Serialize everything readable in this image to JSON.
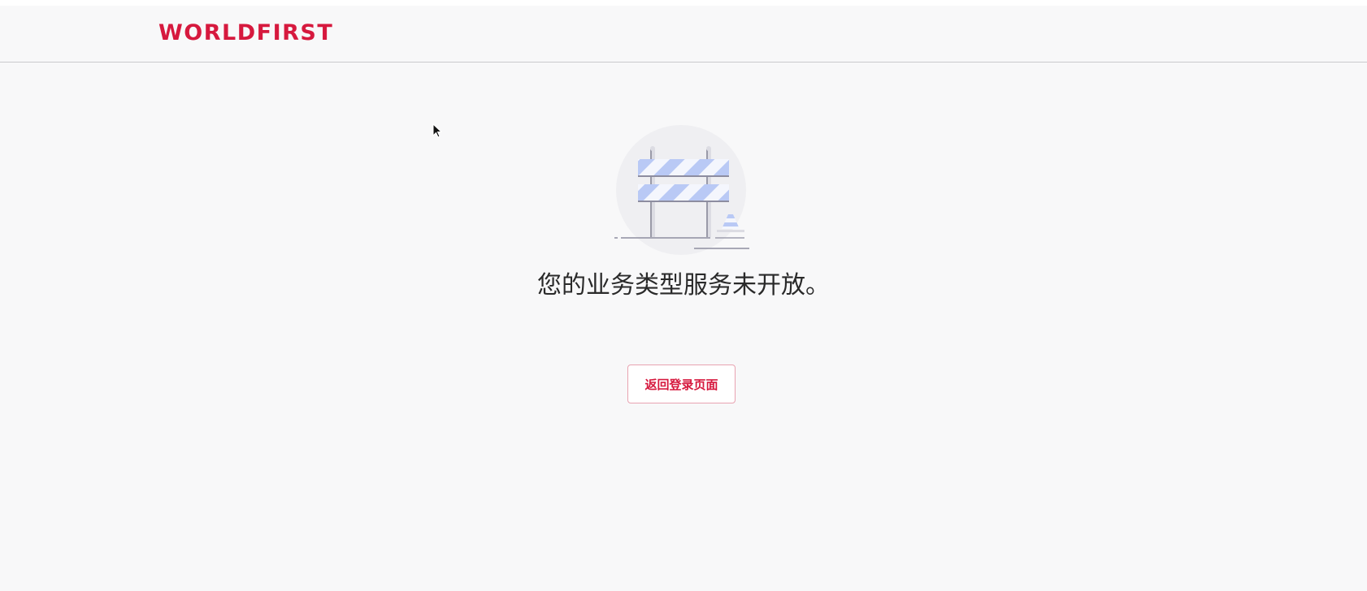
{
  "header": {
    "logo_text": "WORLDFIRST"
  },
  "main": {
    "illustration_icon": "roadblock-barrier-icon",
    "message": "您的业务类型服务未开放。",
    "back_button_label": "返回登录页面"
  },
  "colors": {
    "brand": "#d6193e",
    "background": "#f8f8f9",
    "barrier_stripe": "#b9c9f5",
    "text": "#2a2a2a"
  }
}
